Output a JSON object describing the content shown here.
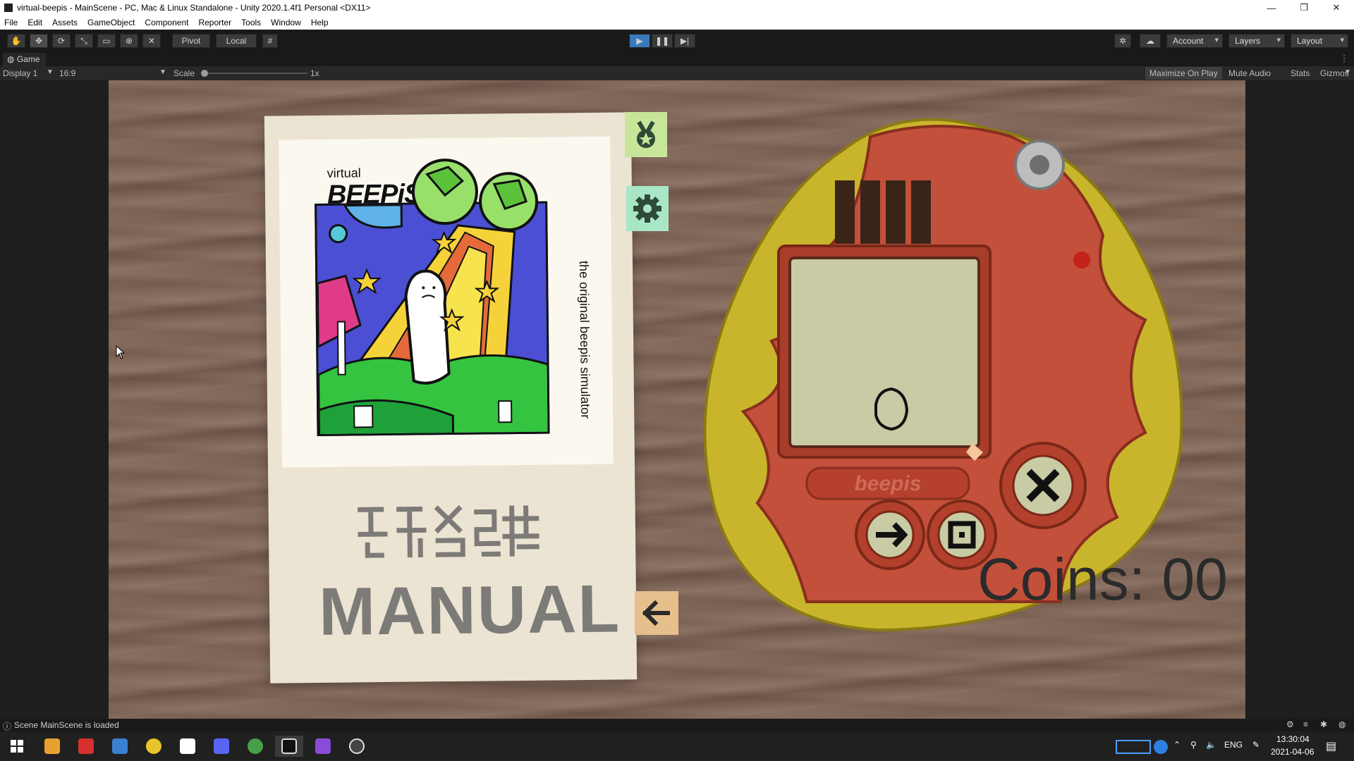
{
  "window": {
    "title": "virtual-beepis - MainScene - PC, Mac & Linux Standalone - Unity 2020.1.4f1 Personal <DX11>",
    "minimize": "—",
    "restore": "❐",
    "close": "✕"
  },
  "menu": [
    "File",
    "Edit",
    "Assets",
    "GameObject",
    "Component",
    "Reporter",
    "Tools",
    "Window",
    "Help"
  ],
  "toolbar": {
    "pivot": "Pivot",
    "local": "Local",
    "account": "Account",
    "layers": "Layers",
    "layout": "Layout"
  },
  "game_tab": {
    "label": "Game",
    "display": "Display 1",
    "aspect": "16:9",
    "scale_label": "Scale",
    "scale_value": "1x",
    "maximize_on_play": "Maximize On Play",
    "mute_audio": "Mute Audio",
    "stats": "Stats",
    "gizmos": "Gizmos"
  },
  "game": {
    "manual": {
      "brand_small": "virtual",
      "brand_big": "BEEPiS",
      "side_text": "the original beepis simulator",
      "title": "MANUAL"
    },
    "device": {
      "logo": "beepis"
    },
    "coins_text": "Coins: 00"
  },
  "status": {
    "message": "Scene MainScene is loaded"
  },
  "taskbar": {
    "language": "ENG",
    "time": "13:30:04",
    "date": "2021-04-06"
  },
  "colors": {
    "unity_dark": "#191919",
    "play_blue": "#3a79bb",
    "device_red": "#c2503a",
    "device_yellow": "#c9b52c",
    "lcd": "#c8cba4"
  }
}
